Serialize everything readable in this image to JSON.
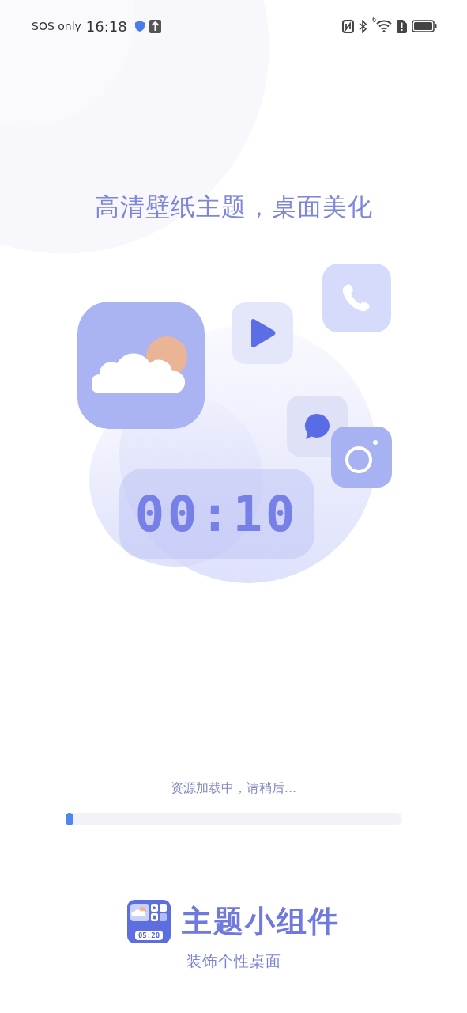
{
  "status_bar": {
    "carrier": "SOS only",
    "time": "16:18",
    "wifi_badge": "6"
  },
  "headline": "高清壁纸主题，桌面美化",
  "illustration": {
    "clock": "00:10"
  },
  "loading": {
    "message": "资源加载中，请稍后...",
    "level": 0.025
  },
  "brand": {
    "logo_time": "05:20",
    "name": "主题小组件",
    "tagline": "装饰个性桌面"
  }
}
